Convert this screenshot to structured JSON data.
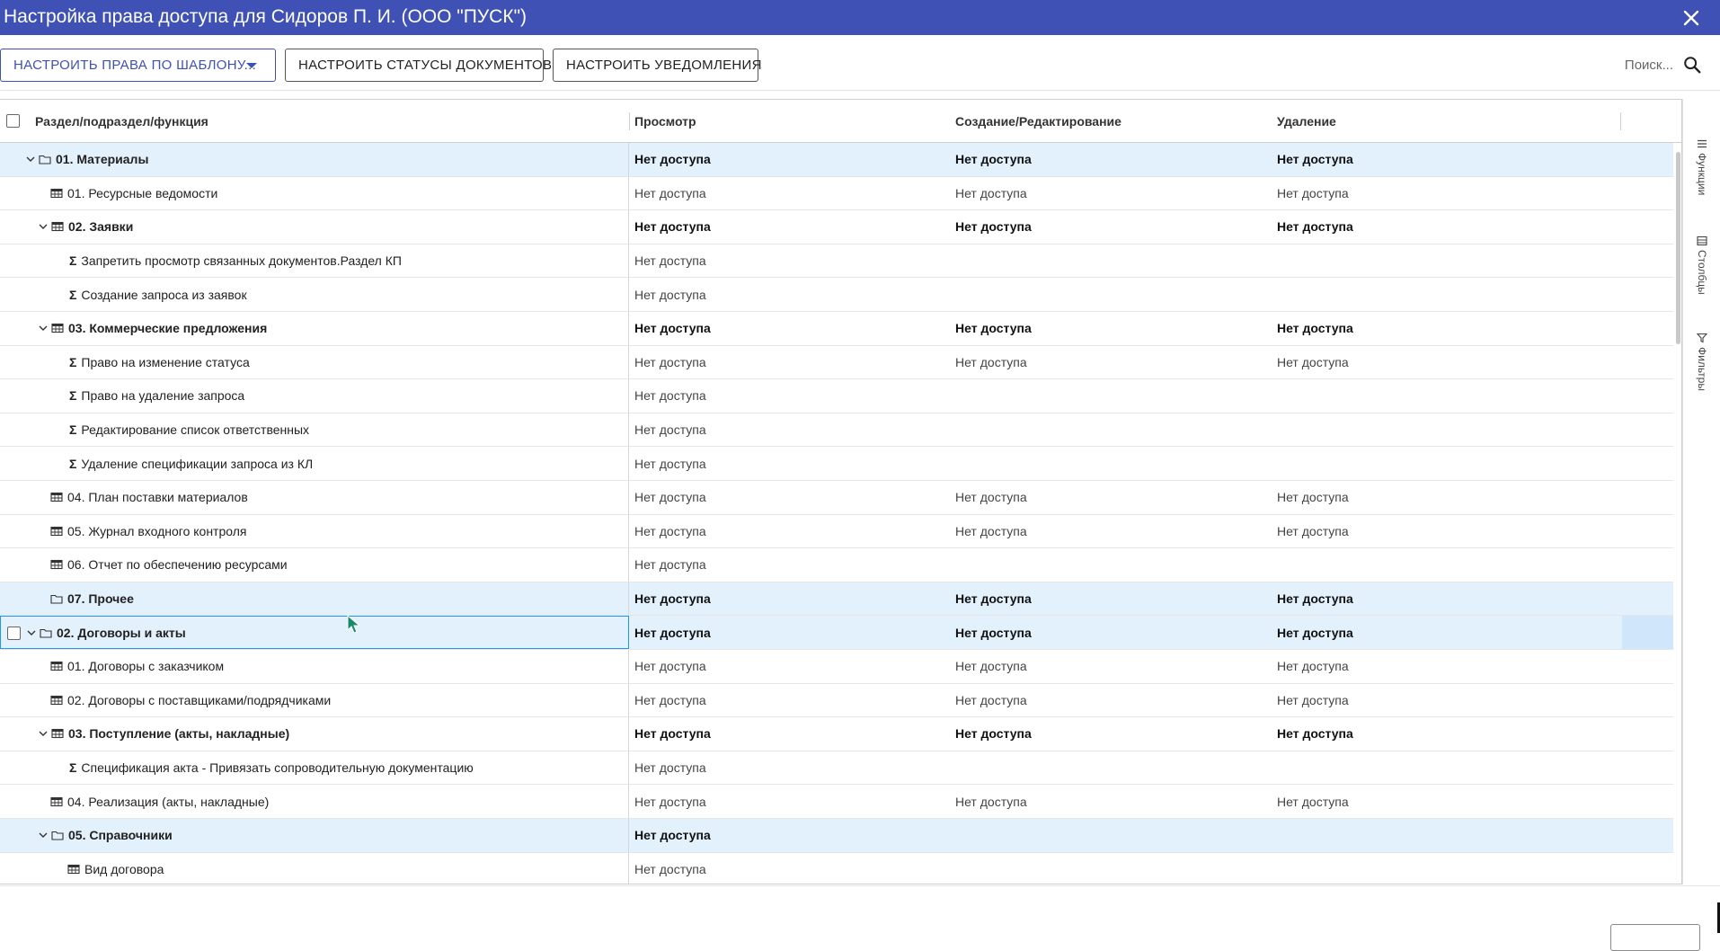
{
  "window": {
    "title": "Настройка права доступа для Сидоров П. И. (ООО \"ПУСК\")",
    "title_bar_color": "#3f51b5"
  },
  "toolbar": {
    "template_button": "НАСТРОИТЬ ПРАВА ПО ШАБЛОНУ...",
    "statuses_button": "НАСТРОИТЬ СТАТУСЫ ДОКУМЕНТОВ",
    "notifications_button": "НАСТРОИТЬ УВЕДОМЛЕНИЯ",
    "search_placeholder": "Поиск..."
  },
  "grid": {
    "columns": [
      "Раздел/подраздел/функция",
      "Просмотр",
      "Создание/Редактирование",
      "Удаление"
    ],
    "rows": [
      {
        "label": "01. Материалы",
        "icon": "folder-icon",
        "expand": "expanded",
        "group": true,
        "highlight": true,
        "view": "Нет доступа",
        "edit": "Нет доступа",
        "delete": "Нет доступа"
      },
      {
        "label": "01. Ресурсные ведомости",
        "icon": "table-icon",
        "expand": "none",
        "group": false,
        "view": "Нет доступа",
        "edit": "Нет доступа",
        "delete": "Нет доступа"
      },
      {
        "label": "02. Заявки",
        "icon": "table-icon",
        "expand": "expanded",
        "group": true,
        "view": "Нет доступа",
        "edit": "Нет доступа",
        "delete": "Нет доступа"
      },
      {
        "label": "Запретить просмотр связанных документов.Раздел КП",
        "icon": "sigma-icon",
        "expand": "none",
        "group": false,
        "view": "Нет доступа",
        "edit": "",
        "delete": ""
      },
      {
        "label": "Создание запроса из заявок",
        "icon": "sigma-icon",
        "expand": "none",
        "group": false,
        "view": "Нет доступа",
        "edit": "",
        "delete": ""
      },
      {
        "label": "03. Коммерческие предложения",
        "icon": "table-icon",
        "expand": "expanded",
        "group": true,
        "view": "Нет доступа",
        "edit": "Нет доступа",
        "delete": "Нет доступа"
      },
      {
        "label": "Право на изменение статуса",
        "icon": "sigma-icon",
        "expand": "none",
        "group": false,
        "view": "Нет доступа",
        "edit": "Нет доступа",
        "delete": "Нет доступа"
      },
      {
        "label": "Право на удаление запроса",
        "icon": "sigma-icon",
        "expand": "none",
        "group": false,
        "view": "Нет доступа",
        "edit": "",
        "delete": ""
      },
      {
        "label": "Редактирование список ответственных",
        "icon": "sigma-icon",
        "expand": "none",
        "group": false,
        "view": "Нет доступа",
        "edit": "",
        "delete": ""
      },
      {
        "label": "Удаление спецификации запроса из КЛ",
        "icon": "sigma-icon",
        "expand": "none",
        "group": false,
        "view": "Нет доступа",
        "edit": "",
        "delete": ""
      },
      {
        "label": "04. План поставки материалов",
        "icon": "table-icon",
        "expand": "none",
        "group": false,
        "view": "Нет доступа",
        "edit": "Нет доступа",
        "delete": "Нет доступа"
      },
      {
        "label": "05. Журнал входного контроля",
        "icon": "table-icon",
        "expand": "none",
        "group": false,
        "view": "Нет доступа",
        "edit": "Нет доступа",
        "delete": "Нет доступа"
      },
      {
        "label": "06. Отчет по обеспечению ресурсами",
        "icon": "table-icon",
        "expand": "none",
        "group": false,
        "view": "Нет доступа",
        "edit": "",
        "delete": ""
      },
      {
        "label": "07. Прочее",
        "icon": "folder-icon",
        "expand": "none",
        "group": true,
        "highlight": true,
        "view": "Нет доступа",
        "edit": "Нет доступа",
        "delete": "Нет доступа"
      },
      {
        "label": "02. Договоры и акты",
        "icon": "folder-icon",
        "expand": "expanded",
        "group": true,
        "focused": true,
        "view": "Нет доступа",
        "edit": "Нет доступа",
        "delete": "Нет доступа"
      },
      {
        "label": "01. Договоры с заказчиком",
        "icon": "table-icon",
        "expand": "none",
        "group": false,
        "view": "Нет доступа",
        "edit": "Нет доступа",
        "delete": "Нет доступа"
      },
      {
        "label": "02. Договоры с поставщиками/подрядчиками",
        "icon": "table-icon",
        "expand": "none",
        "group": false,
        "view": "Нет доступа",
        "edit": "Нет доступа",
        "delete": "Нет доступа"
      },
      {
        "label": "03. Поступление (акты, накладные)",
        "icon": "table-icon",
        "expand": "expanded",
        "group": true,
        "view": "Нет доступа",
        "edit": "Нет доступа",
        "delete": "Нет доступа"
      },
      {
        "label": "Спецификация акта - Привязать сопроводительную документацию",
        "icon": "sigma-icon",
        "expand": "none",
        "group": false,
        "view": "Нет доступа",
        "edit": "",
        "delete": ""
      },
      {
        "label": "04. Реализация (акты, накладные)",
        "icon": "table-icon",
        "expand": "none",
        "group": false,
        "view": "Нет доступа",
        "edit": "Нет доступа",
        "delete": "Нет доступа"
      },
      {
        "label": "05. Справочники",
        "icon": "folder-icon",
        "expand": "expanded",
        "group": true,
        "highlight": true,
        "view": "Нет доступа",
        "edit": "",
        "delete": ""
      },
      {
        "label": "Вид договора",
        "icon": "table-icon",
        "expand": "none",
        "group": false,
        "view": "Нет доступа",
        "edit": "",
        "delete": ""
      }
    ]
  },
  "side_panel": {
    "tabs": [
      {
        "label": "Функции",
        "icon": "menu-icon"
      },
      {
        "label": "Столбцы",
        "icon": "columns-icon"
      },
      {
        "label": "Фильтры",
        "icon": "filter-icon"
      }
    ]
  },
  "colors": {
    "accent": "#3f51b5",
    "row_highlight": "#e3f1fc",
    "focus_border": "#2196f3"
  }
}
